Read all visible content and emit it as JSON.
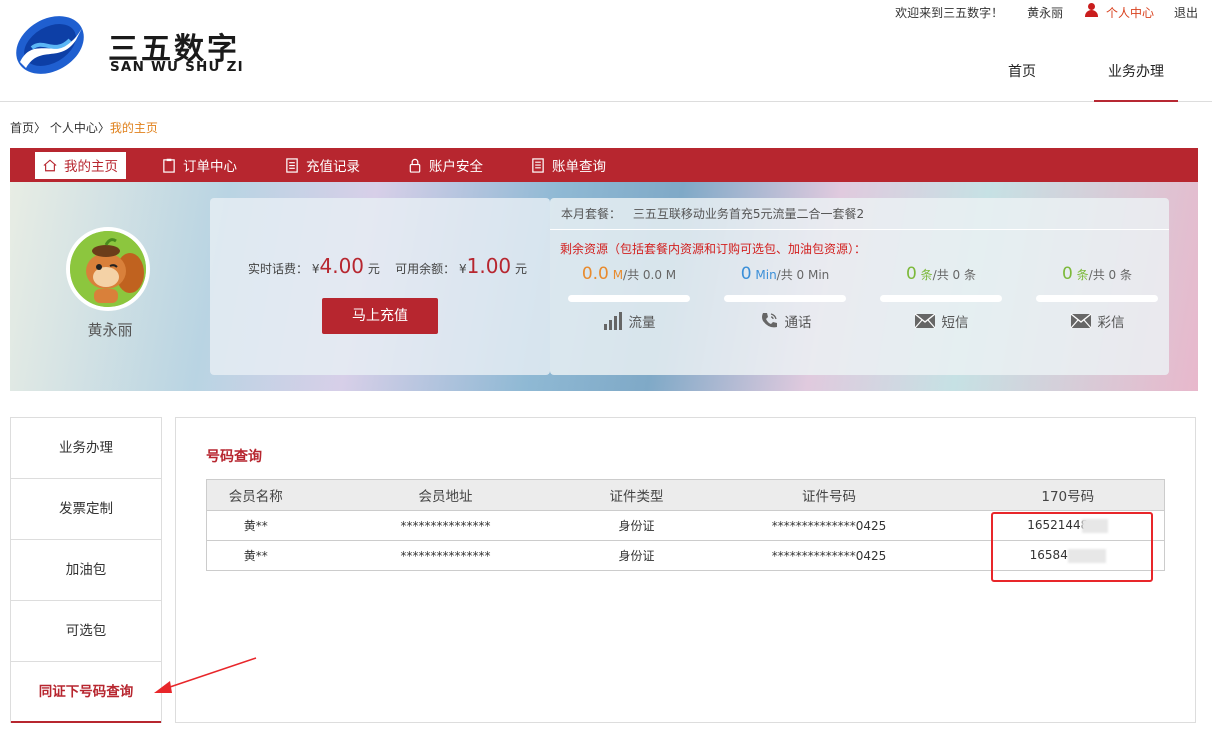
{
  "brand": {
    "name_cn": "三五数字",
    "name_en": "SAN WU SHU ZI"
  },
  "topbar": {
    "welcome": "欢迎来到三五数字！",
    "user_name": "黄永丽",
    "user_center": "个人中心",
    "logout": "退出"
  },
  "main_nav": {
    "home": "首页",
    "business": "业务办理",
    "active": "业务办理"
  },
  "breadcrumb": {
    "home": "首页",
    "sep1": "〉",
    "center": "个人中心",
    "sep2": "〉",
    "current": "我的主页"
  },
  "tabs": [
    {
      "label": "我的主页",
      "icon": "home-icon",
      "active": true
    },
    {
      "label": "订单中心",
      "icon": "clipboard-icon",
      "active": false
    },
    {
      "label": "充值记录",
      "icon": "document-icon",
      "active": false
    },
    {
      "label": "账户安全",
      "icon": "lock-icon",
      "active": false
    },
    {
      "label": "账单查询",
      "icon": "bill-icon",
      "active": false
    }
  ],
  "profile": {
    "name": "黄永丽"
  },
  "balance": {
    "realtime_label": "实时话费：",
    "currency": "¥",
    "realtime_value": "4.00",
    "unit": "元",
    "available_label": "可用余额：",
    "available_value": "1.00",
    "recharge_button": "马上充值"
  },
  "plan": {
    "label": "本月套餐：",
    "name": "三五互联移动业务首充5元流量二合一套餐2",
    "resources_title": "剩余资源（包括套餐内资源和订购可选包、加油包资源）：",
    "items": [
      {
        "value": "0.0",
        "unit": "M",
        "total_text": "/共 0.0 M",
        "label": "流量",
        "icon": "signal-bars-icon",
        "color": "#e88b2e"
      },
      {
        "value": "0",
        "unit": "Min",
        "total_text": "/共 0 Min",
        "label": "通话",
        "icon": "phone-icon",
        "color": "#3b8fd8"
      },
      {
        "value": "0",
        "unit": "条",
        "total_text": "/共 0 条",
        "label": "短信",
        "icon": "envelope-icon",
        "color": "#7cb93a"
      },
      {
        "value": "0",
        "unit": "条",
        "total_text": "/共 0 条",
        "label": "彩信",
        "icon": "envelope-icon",
        "color": "#7cb93a"
      }
    ]
  },
  "side_menu": [
    {
      "label": "业务办理",
      "active": false
    },
    {
      "label": "发票定制",
      "active": false
    },
    {
      "label": "加油包",
      "active": false
    },
    {
      "label": "可选包",
      "active": false
    },
    {
      "label": "同证下号码查询",
      "active": true
    }
  ],
  "number_query": {
    "title": "号码查询",
    "columns": [
      "会员名称",
      "会员地址",
      "证件类型",
      "证件号码",
      "170号码"
    ],
    "rows": [
      [
        "黄**",
        "***************",
        "身份证",
        "**************0425",
        "16521448"
      ],
      [
        "黄**",
        "***************",
        "身份证",
        "**************0425",
        "16584"
      ]
    ]
  }
}
